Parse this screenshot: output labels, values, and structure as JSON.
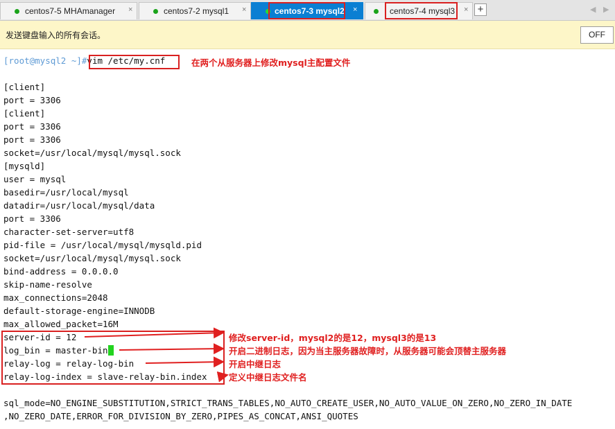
{
  "tabs": [
    {
      "label": "centos7-5 MHAmanager",
      "close": "×"
    },
    {
      "label": "centos7-2 mysql1",
      "close": "×"
    },
    {
      "label": "centos7-3 mysql2",
      "close": "×"
    },
    {
      "label": "centos7-4 mysql3",
      "close": "×"
    }
  ],
  "tab_add": "+",
  "nav": {
    "prev": "◀",
    "next": "▶"
  },
  "notice": {
    "text": "发送键盘输入的所有会话。",
    "button": "OFF"
  },
  "terminal": {
    "prompt": "[root@mysql2 ~]#",
    "command": "vim /etc/my.cnf",
    "lines": [
      "[client]",
      "port = 3306",
      "[client]",
      "port = 3306",
      "port = 3306",
      "socket=/usr/local/mysql/mysql.sock",
      "[mysqld]",
      "user = mysql",
      "basedir=/usr/local/mysql",
      "datadir=/usr/local/mysql/data",
      "port = 3306",
      "character-set-server=utf8",
      "pid-file = /usr/local/mysql/mysqld.pid",
      "socket=/usr/local/mysql/mysql.sock",
      "bind-address = 0.0.0.0",
      "skip-name-resolve",
      "max_connections=2048",
      "default-storage-engine=INNODB",
      "max_allowed_packet=16M",
      "server-id = 12",
      "log_bin = master-bin",
      "relay-log = relay-log-bin",
      "relay-log-index = slave-relay-bin.index",
      "",
      "sql_mode=NO_ENGINE_SUBSTITUTION,STRICT_TRANS_TABLES,NO_AUTO_CREATE_USER,NO_AUTO_VALUE_ON_ZERO,NO_ZERO_IN_DATE",
      ",NO_ZERO_DATE,ERROR_FOR_DIVISION_BY_ZERO,PIPES_AS_CONCAT,ANSI_QUOTES"
    ]
  },
  "annotations": {
    "cmd": "在两个从服务器上修改mysql主配置文件",
    "server_id": "修改server-id，mysql2的是12，mysql3的是13",
    "log_bin": "开启二进制日志，因为当主服务器故障时，从服务器可能会顶替主服务器",
    "relay_log": "开启中继日志",
    "relay_log_index": "定义中继日志文件名"
  },
  "colors": {
    "active_tab": "#0a7fd3",
    "annotation": "#e02020",
    "notice_bg": "#fdf6c8",
    "cursor": "#22d31f",
    "status_dot": "#1aa31a"
  }
}
